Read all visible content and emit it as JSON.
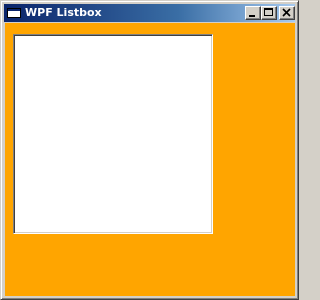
{
  "window": {
    "title": "WPF Listbox",
    "background_color": "#ffa500",
    "titlebar_colors": [
      "#0a246a",
      "#a6caf0"
    ]
  },
  "caption_buttons": {
    "minimize_icon": "minimize-icon",
    "maximize_icon": "maximize-icon",
    "close_icon": "close-icon"
  },
  "listbox": {
    "items": [],
    "background_color": "#ffffff"
  }
}
